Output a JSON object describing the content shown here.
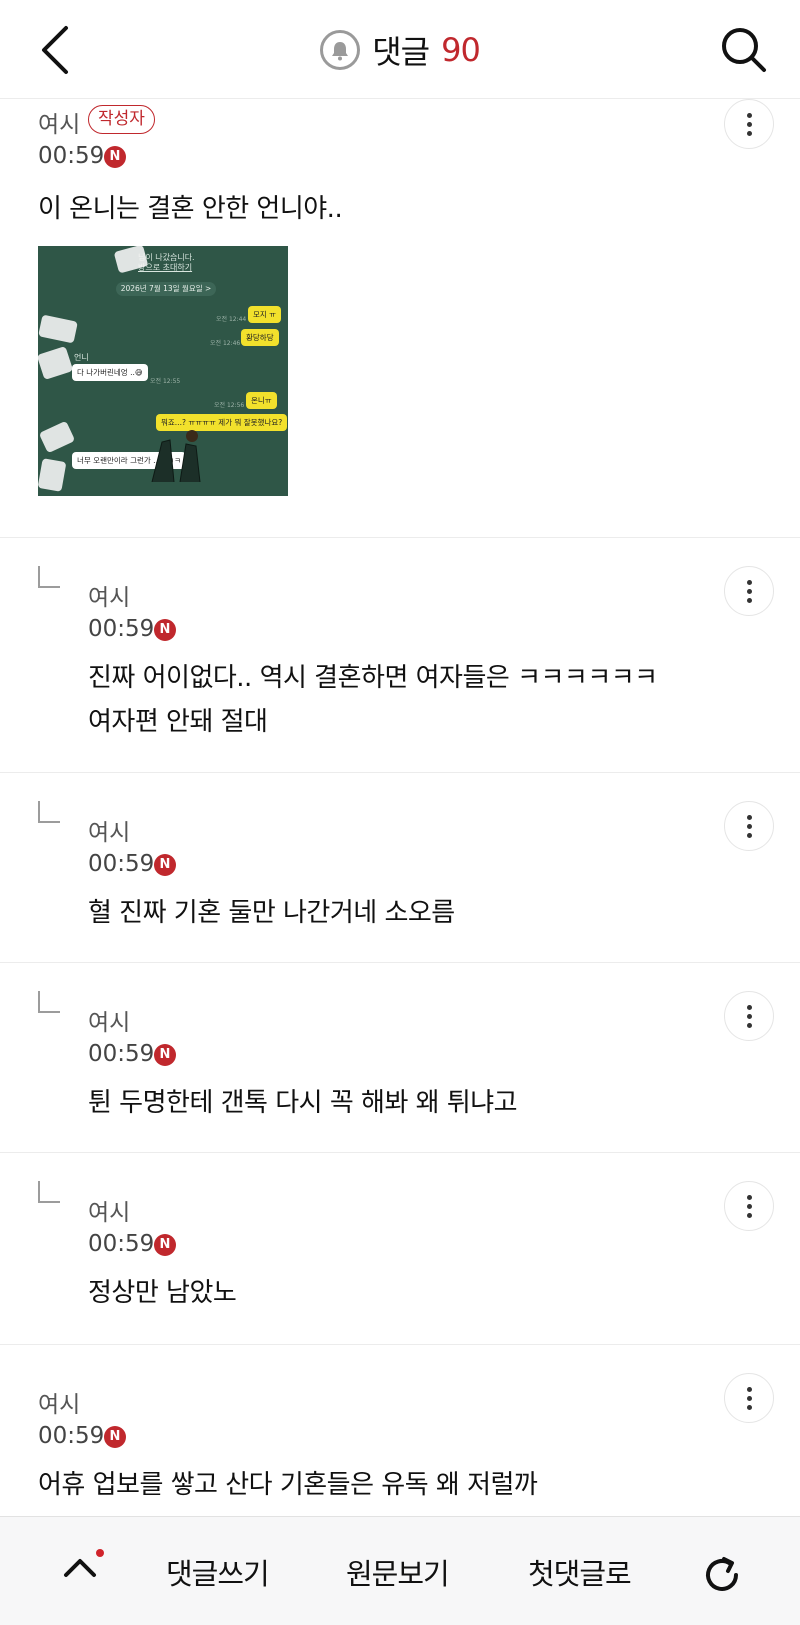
{
  "header": {
    "title": "댓글",
    "count": "90"
  },
  "comments": [
    {
      "author": "여시",
      "op_badge": "작성자",
      "time": "00:59",
      "nbadge": "N",
      "text": "이 온니는 결혼 안한 언니야..",
      "is_reply": false
    },
    {
      "author": "여시",
      "time": "00:59",
      "nbadge": "N",
      "text": "진짜 어이없다.. 역시 결혼하면 여자들은 ㅋㅋㅋㅋㅋㅋ\n여자편 안돼 절대",
      "is_reply": true
    },
    {
      "author": "여시",
      "time": "00:59",
      "nbadge": "N",
      "text": "혈 진짜 기혼 둘만 나간거네 소오름",
      "is_reply": true
    },
    {
      "author": "여시",
      "time": "00:59",
      "nbadge": "N",
      "text": "튄 두명한테 갠톡 다시 꼭 해봐 왜 튀냐고",
      "is_reply": true
    },
    {
      "author": "여시",
      "time": "00:59",
      "nbadge": "N",
      "text": "정상만 남았노",
      "is_reply": true
    },
    {
      "author": "여시",
      "time": "00:59",
      "nbadge": "N",
      "text": "어휴 업보를 쌓고 산다 기혼들은 유독 왜 저럴까",
      "is_reply": false
    }
  ],
  "chat_image": {
    "system_line1": "님이 나갔습니다.",
    "system_line2": "방으로 초대하기",
    "date": "2026년 7월 13일 월요일 >",
    "messages": [
      {
        "text": "모지 ㅠ",
        "side": "right"
      },
      {
        "text": "황당하당",
        "side": "right"
      },
      {
        "text": "다 나가버린네엉 ..😅",
        "side": "left"
      },
      {
        "text": "온니ㅠ",
        "side": "right"
      },
      {
        "text": "뭐죠...? ㅠㅠㅠㅠ 제가 뭐 잘못했나요?",
        "side": "right"
      },
      {
        "text": "너무 오랜만이라 그런가 .. ㅋㅋㅋ",
        "side": "left"
      }
    ],
    "sender_label": "언니",
    "times": [
      "오전 12:44",
      "오전 12:46",
      "오전 12:55",
      "오전 12:56"
    ]
  },
  "bottom_bar": {
    "write": "댓글쓰기",
    "original": "원문보기",
    "first": "첫댓글로"
  },
  "colors": {
    "accent": "#c0282d",
    "chat_bg": "#2f5647",
    "chat_yellow": "#f2e12c"
  },
  "icons": [
    "back-arrow-icon",
    "bell-icon",
    "search-icon",
    "more-vertical-icon",
    "chevron-up-icon",
    "refresh-icon",
    "reply-arrow-icon"
  ]
}
